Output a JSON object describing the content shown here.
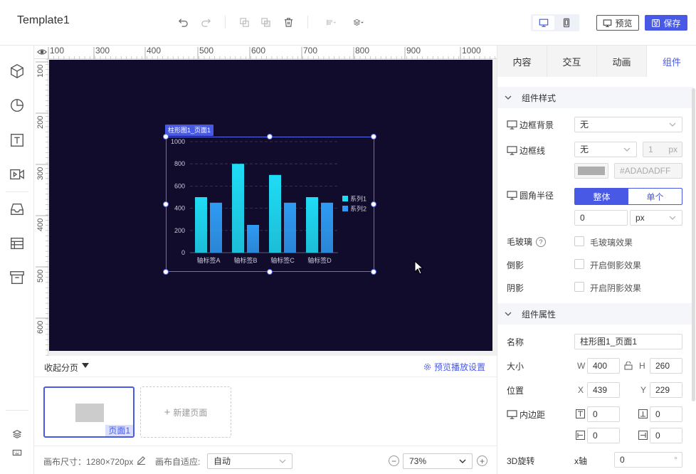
{
  "header": {
    "title": "Template1",
    "preview_label": "预览",
    "save_label": "保存"
  },
  "canvas": {
    "ruler_top_labels": [
      "100",
      "300",
      "400",
      "500",
      "600",
      "700",
      "800",
      "900",
      "1000"
    ],
    "ruler_left_labels": [
      "100",
      "200",
      "300",
      "400",
      "500",
      "600"
    ],
    "component_tag": "柱形图1_页面1"
  },
  "chart_data": {
    "type": "bar",
    "categories": [
      "轴标签A",
      "轴标签B",
      "轴标签C",
      "轴标签D"
    ],
    "series": [
      {
        "name": "系列1",
        "values": [
          500,
          800,
          700,
          500
        ],
        "color": "#1fdcf5"
      },
      {
        "name": "系列2",
        "values": [
          450,
          250,
          450,
          450
        ],
        "color": "#2e9bf3"
      }
    ],
    "ylim": [
      0,
      1000
    ],
    "yticks": [
      "0",
      "200",
      "400",
      "600",
      "800",
      "1000"
    ],
    "legend_position": "right",
    "grid": true
  },
  "pages": {
    "collapse_label": "收起分页",
    "play_settings": "预览播放设置",
    "items": [
      {
        "label": "页面1"
      }
    ],
    "new_page_label": "新建页面"
  },
  "status": {
    "canvas_size": "画布尺寸：1280×720px",
    "adapt_label": "画布自适应:",
    "adapt_value": "自动",
    "zoom": "73%"
  },
  "right_panel": {
    "tabs": [
      "内容",
      "交互",
      "动画",
      "组件"
    ],
    "active_tab": "组件",
    "style_section": {
      "title": "组件样式",
      "border_bg_label": "边框背景",
      "border_bg_value": "无",
      "border_line_label": "边框线",
      "border_line_value": "无",
      "border_width": "1",
      "border_width_unit": "px",
      "border_color_hex": "#ADADADFF",
      "radius_label": "圆角半径",
      "radius_options": [
        "整体",
        "单个"
      ],
      "radius_value": "0",
      "radius_unit": "px",
      "glass_label": "毛玻璃",
      "glass_check": "毛玻璃效果",
      "reflection_label": "倒影",
      "reflection_check": "开启倒影效果",
      "shadow_label": "阴影",
      "shadow_check": "开启阴影效果"
    },
    "props_section": {
      "title": "组件属性",
      "name_label": "名称",
      "name_value": "柱形图1_页面1",
      "size_label": "大小",
      "w_letter": "W",
      "w_value": "400",
      "h_letter": "H",
      "h_value": "260",
      "pos_label": "位置",
      "x_letter": "X",
      "x_value": "439",
      "y_letter": "Y",
      "y_value": "229",
      "padding_label": "内边距",
      "padding_values": [
        "0",
        "0",
        "0",
        "0"
      ],
      "rotate_label": "3D旋转",
      "rotate_axis": "x轴",
      "rotate_value": "0",
      "rotate_unit": "°"
    }
  }
}
